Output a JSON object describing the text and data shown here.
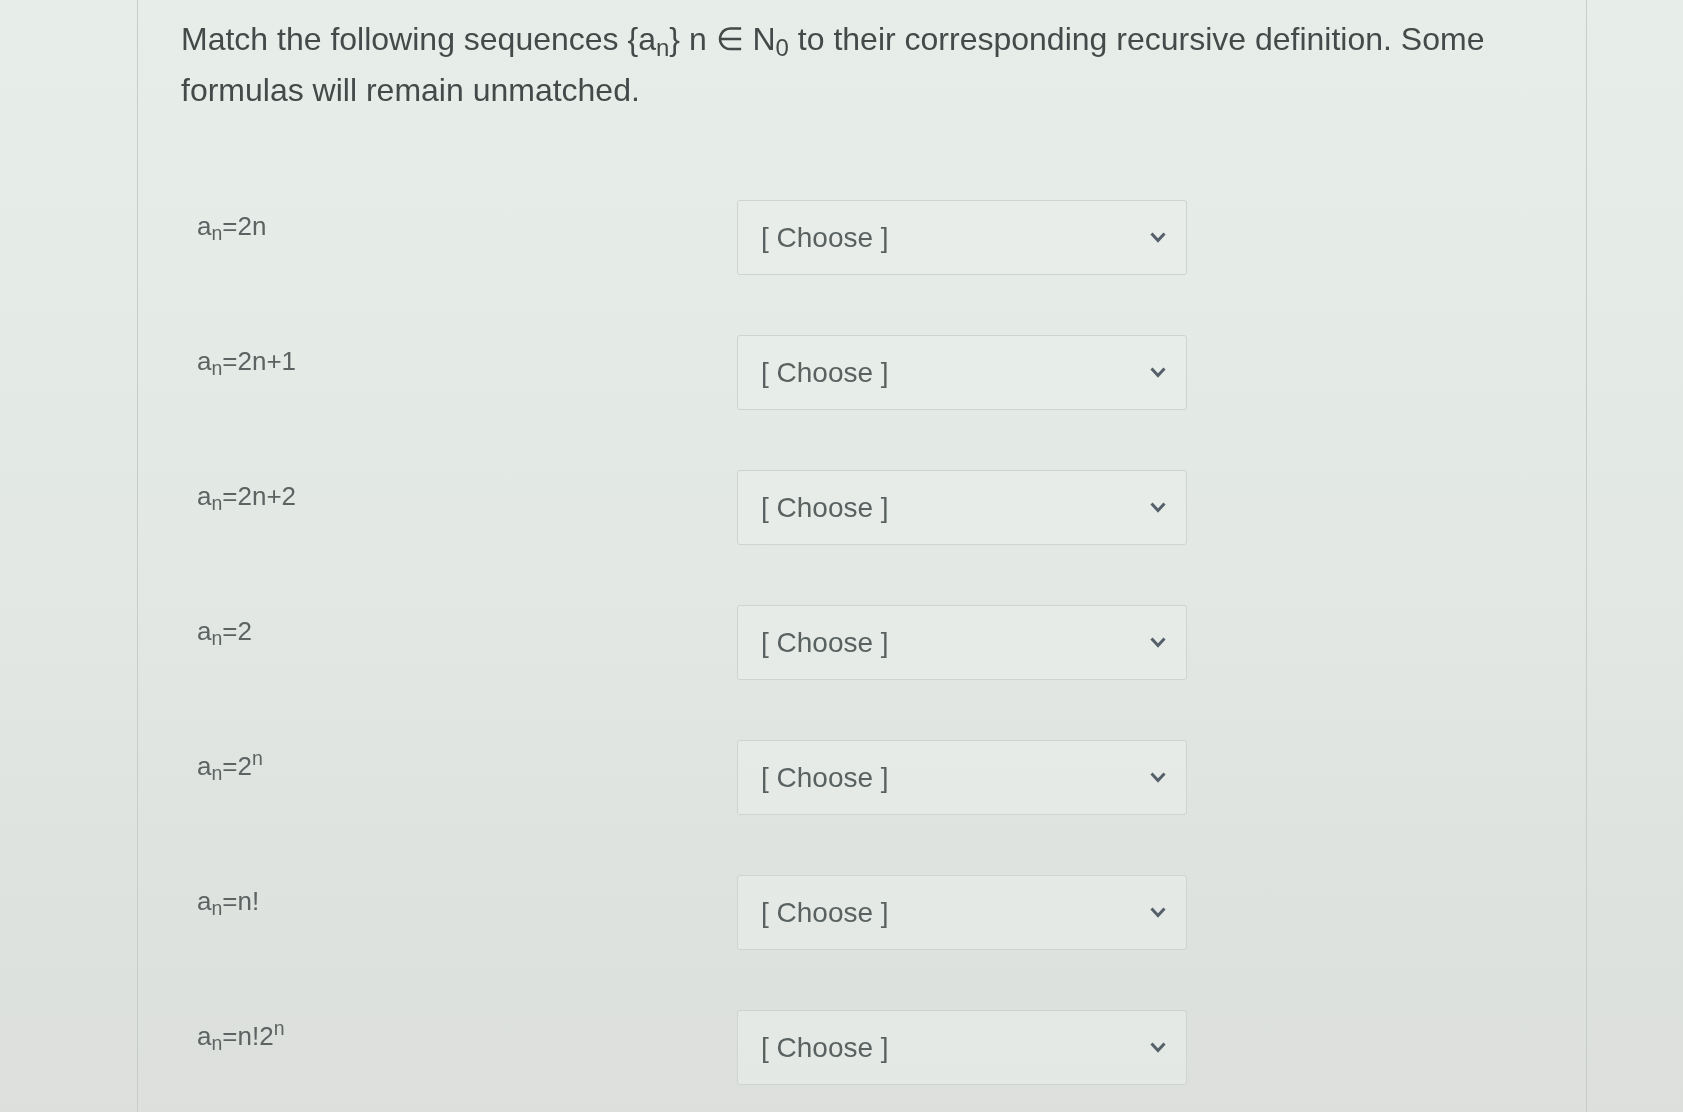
{
  "question": {
    "prompt": "Match the following sequences {a$_{n}$} n ∈ N$_{0}$ to their corresponding recursive definition. Some formulas will remain unmatched."
  },
  "pairs": [
    {
      "formula": "a$_{n}$=2n",
      "selection": "[ Choose ]"
    },
    {
      "formula": "a$_{n}$=2n+1",
      "selection": "[ Choose ]"
    },
    {
      "formula": "a$_{n}$=2n+2",
      "selection": "[ Choose ]"
    },
    {
      "formula": "a$_{n}$=2",
      "selection": "[ Choose ]"
    },
    {
      "formula": "a$_{n}$=2$^{n}$",
      "selection": "[ Choose ]"
    },
    {
      "formula": "a$_{n}$=n!",
      "selection": "[ Choose ]"
    },
    {
      "formula": "a$_{n}$=n!2$^{n}$",
      "selection": "[ Choose ]"
    }
  ]
}
